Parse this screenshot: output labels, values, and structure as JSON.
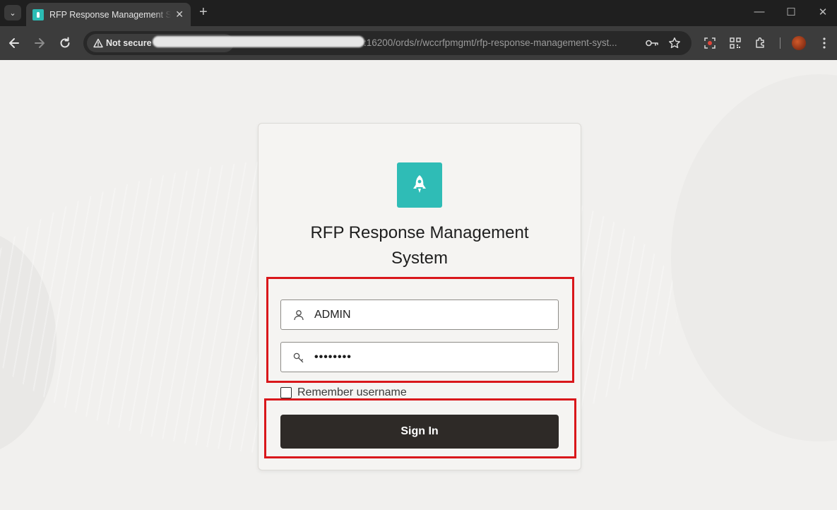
{
  "browser": {
    "tab_title": "RFP Response Management System",
    "tab_close": "✕",
    "new_tab": "+",
    "security_label": "Not secure",
    "url_visible": ":16200/ords/r/wccrfpmgmt/rfp-response-management-syst...",
    "window_controls": {
      "minimize": "—",
      "maximize": "☐",
      "close": "✕"
    }
  },
  "login": {
    "app_title": "RFP Response Management System",
    "username_value": "ADMIN",
    "password_value": "••••••••",
    "remember_label": "Remember username",
    "remember_checked": false,
    "sign_in_label": "Sign In"
  },
  "colors": {
    "app_icon_bg": "#2fbcb6",
    "sign_in_bg": "#2e2a27",
    "annotation_red": "#d9171b"
  },
  "icons": [
    "tab-search-icon",
    "back-icon",
    "forward-icon",
    "reload-icon",
    "warning-icon",
    "key-icon",
    "star-icon",
    "screen-record-icon",
    "qr-code-icon",
    "extensions-icon",
    "menu-icon",
    "rocket-icon",
    "user-icon",
    "password-key-icon"
  ]
}
